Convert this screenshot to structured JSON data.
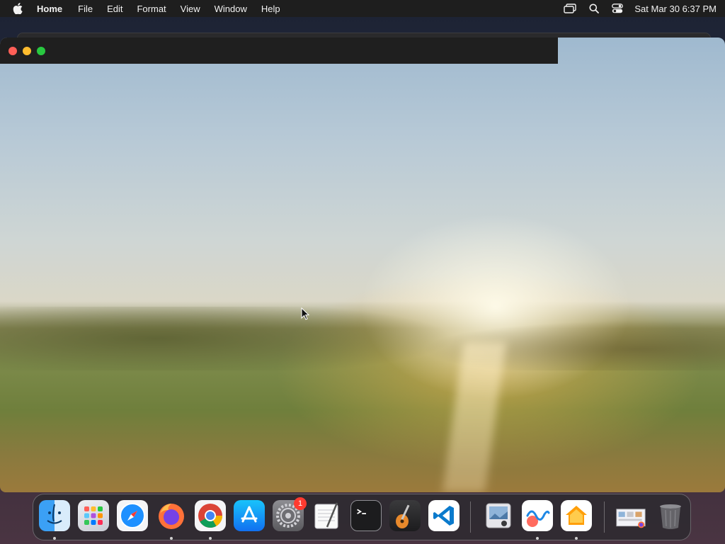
{
  "menubar": {
    "apple_icon": "apple-icon",
    "app_name": "Home",
    "menus": [
      "File",
      "Edit",
      "Format",
      "View",
      "Window",
      "Help"
    ],
    "tray": [
      "screen-mirroring-icon",
      "spotlight-search-icon",
      "control-center-icon"
    ],
    "clock": "Sat Mar 30  6:37 PM"
  },
  "window": {
    "traffic_lights": [
      "close",
      "minimize",
      "zoom"
    ],
    "colors": {
      "close": "#ff5f57",
      "minimize": "#febc2e",
      "zoom": "#28c840"
    }
  },
  "dock": {
    "apps": [
      {
        "name": "Finder",
        "icon": "finder-icon",
        "running": true
      },
      {
        "name": "Launchpad",
        "icon": "launchpad-icon",
        "running": false
      },
      {
        "name": "Safari",
        "icon": "safari-icon",
        "running": false
      },
      {
        "name": "Firefox",
        "icon": "firefox-icon",
        "running": true
      },
      {
        "name": "Google Chrome",
        "icon": "chrome-icon",
        "running": true
      },
      {
        "name": "App Store",
        "icon": "app-store-icon",
        "running": false
      },
      {
        "name": "System Settings",
        "icon": "system-settings-icon",
        "running": false,
        "badge": "1"
      },
      {
        "name": "TextEdit",
        "icon": "textedit-icon",
        "running": false
      },
      {
        "name": "Terminal",
        "icon": "terminal-icon",
        "running": false
      },
      {
        "name": "GarageBand",
        "icon": "garageband-icon",
        "running": false
      },
      {
        "name": "Visual Studio Code",
        "icon": "vscode-icon",
        "running": false
      },
      {
        "name": "Preview",
        "icon": "preview-icon",
        "running": false
      },
      {
        "name": "Freeform",
        "icon": "freeform-icon",
        "running": true
      },
      {
        "name": "Home",
        "icon": "home-icon",
        "running": true
      },
      {
        "name": "Downloads",
        "icon": "downloads-stack-icon",
        "running": false
      },
      {
        "name": "Trash",
        "icon": "trash-icon",
        "running": false
      }
    ]
  }
}
